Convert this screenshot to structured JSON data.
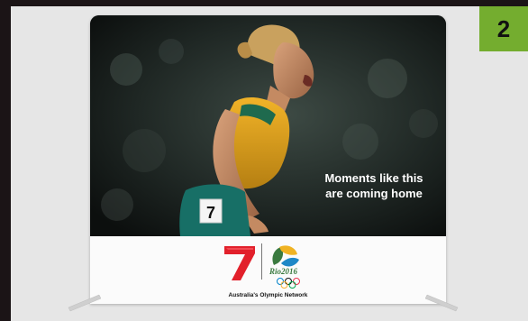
{
  "badge": {
    "number": "2"
  },
  "banner": {
    "tagline": {
      "line1": "Moments like this",
      "line2": "are coming home"
    },
    "bib_number": "7",
    "footer": {
      "network_label": "Australia's Olympic Network",
      "rio_label": "Rio2016"
    }
  },
  "colors": {
    "badge": "#74ad2f",
    "seven_red": "#e2202b",
    "rio_green": "#3a7a3f",
    "background": "#e6e6e6"
  }
}
